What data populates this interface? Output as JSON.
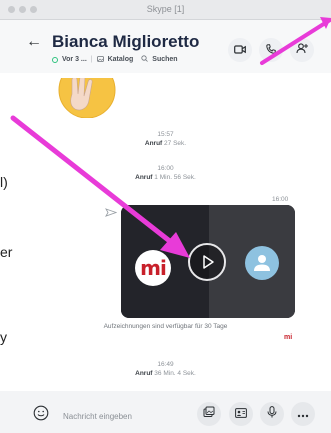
{
  "window": {
    "title": "Skype [1]"
  },
  "header": {
    "contact_name": "Bianca Miglioretto",
    "status_text": "Vor 3 ...",
    "gallery_label": "Katalog",
    "search_label": "Suchen"
  },
  "messages": [
    {
      "time": "15:57",
      "label": "Anruf",
      "duration": "27 Sek."
    },
    {
      "time": "16:00",
      "label": "Anruf",
      "duration": "1 Min. 56 Sek."
    }
  ],
  "recording": {
    "time": "16:00",
    "avatar_text": "mi",
    "caption": "Aufzeichnungen sind verfügbar für 30 Tage",
    "brand_mini": "mi"
  },
  "last_message": {
    "time": "16:49",
    "label": "Anruf",
    "duration": "36 Min. 4 Sek."
  },
  "composer": {
    "placeholder": "Nachricht eingeben"
  },
  "background_fragments": [
    "l)",
    "er",
    "y"
  ],
  "colors": {
    "accent": "#e83bd8",
    "brand_red": "#c8202a",
    "online": "#2ec27e"
  }
}
